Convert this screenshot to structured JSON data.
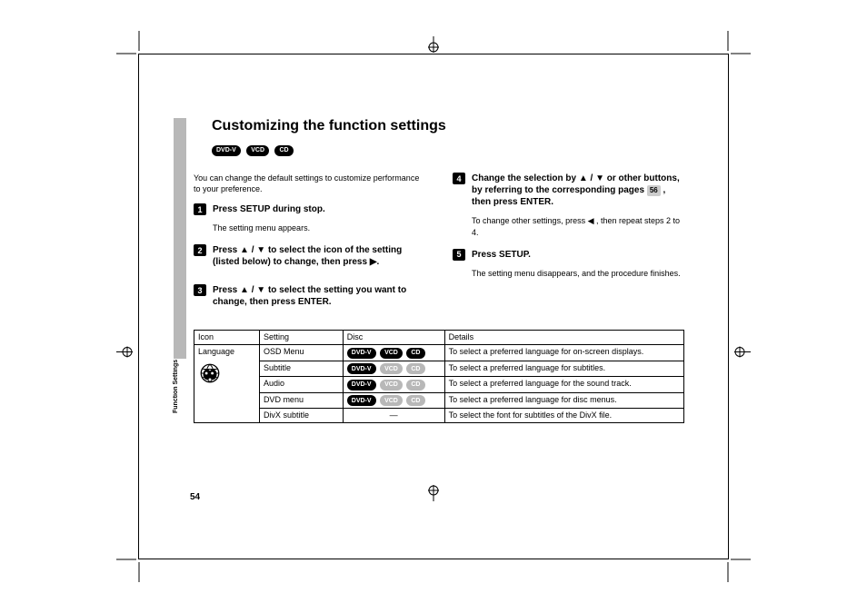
{
  "title": "Customizing the function settings",
  "disc_badges": [
    "DVD-V",
    "VCD",
    "CD"
  ],
  "intro": "You can change the default settings to customize performance to your preference.",
  "section_label": "Function Settings",
  "page_number": "54",
  "steps": [
    {
      "num": "1",
      "text": "Press SETUP during stop.",
      "sub": "The setting menu appears."
    },
    {
      "num": "2",
      "text_parts": [
        "Press ",
        "▲",
        " / ",
        "▼",
        " to select the icon of the setting (listed below) to change, then press ",
        "▶",
        "."
      ]
    },
    {
      "num": "3",
      "text_parts": [
        "Press ",
        "▲",
        " / ",
        "▼",
        " to select the setting you want to change, then press ENTER."
      ]
    },
    {
      "num": "4",
      "text_parts": [
        "Change the selection by ",
        "▲",
        " / ",
        "▼",
        " or other buttons, by referring to the corresponding pages ",
        "56",
        " , then press ENTER."
      ],
      "sub_parts": [
        "To change other settings, press ",
        "◀",
        " , then repeat steps 2 to 4."
      ]
    },
    {
      "num": "5",
      "text": "Press SETUP.",
      "sub": "The setting menu disappears, and the procedure finishes."
    }
  ],
  "table": {
    "headers": [
      "Icon",
      "Setting",
      "Disc",
      "Details"
    ],
    "icon_label": "Language",
    "rows": [
      {
        "setting": "OSD Menu",
        "discs": [
          {
            "t": "DVD-V",
            "on": true
          },
          {
            "t": "VCD",
            "on": true
          },
          {
            "t": "CD",
            "on": true
          }
        ],
        "details": "To select a preferred language for on-screen displays."
      },
      {
        "setting": "Subtitle",
        "discs": [
          {
            "t": "DVD-V",
            "on": true
          },
          {
            "t": "VCD",
            "on": false
          },
          {
            "t": "CD",
            "on": false
          }
        ],
        "details": "To select a preferred language for subtitles."
      },
      {
        "setting": "Audio",
        "discs": [
          {
            "t": "DVD-V",
            "on": true
          },
          {
            "t": "VCD",
            "on": false
          },
          {
            "t": "CD",
            "on": false
          }
        ],
        "details": "To select a preferred language for the sound track."
      },
      {
        "setting": "DVD menu",
        "discs": [
          {
            "t": "DVD-V",
            "on": true
          },
          {
            "t": "VCD",
            "on": false
          },
          {
            "t": "CD",
            "on": false
          }
        ],
        "details": "To select a preferred language for disc menus."
      },
      {
        "setting": "DivX subtitle",
        "discs_dash": "—",
        "details": "To select the font for subtitles of the DivX file."
      }
    ]
  }
}
